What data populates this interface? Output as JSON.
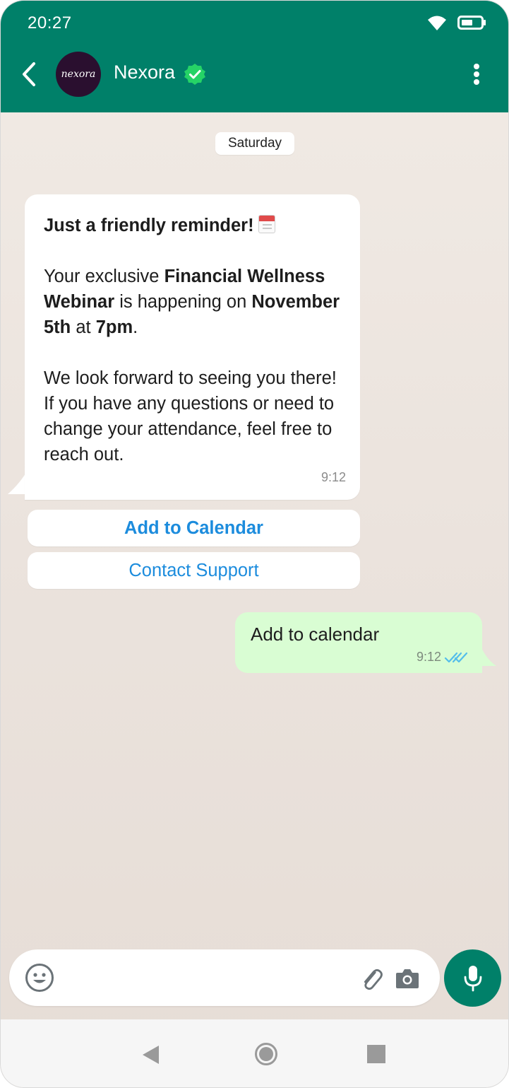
{
  "status_bar": {
    "time": "20:27",
    "wifi_icon": "wifi-icon",
    "battery_icon": "battery-icon"
  },
  "header": {
    "contact_name": "Nexora",
    "avatar_text": "nexora",
    "verified_icon": "verified-badge-icon",
    "back_icon": "back-arrow-icon",
    "menu_icon": "more-vert-icon",
    "bg_color": "#008069"
  },
  "chat": {
    "date_label": "Saturday",
    "incoming": {
      "heading": "Just a friendly reminder!",
      "p2_pre": "Your exclusive ",
      "p2_bold_1": "Financial Wellness Webinar",
      "p2_mid": " is happening on ",
      "p2_bold_2": "November 5th",
      "p2_mid_2": " at ",
      "p2_bold_3": "7pm",
      "p2_end": ".",
      "p3": "We look forward to seeing you there! If you have any questions or need to change your attendance, feel free to reach out.",
      "time": "9:12"
    },
    "quick_replies": [
      "Add to Calendar",
      "Contact Support"
    ],
    "outgoing": {
      "text": "Add to calendar",
      "time": "9:12",
      "status_icon": "double-check-icon"
    }
  },
  "input_bar": {
    "placeholder": "",
    "emoji_icon": "emoji-icon",
    "attach_icon": "paperclip-icon",
    "camera_icon": "camera-icon",
    "mic_icon": "mic-icon"
  },
  "nav_bar": {
    "back": "nav-back-icon",
    "home": "nav-home-icon",
    "recents": "nav-recents-icon"
  },
  "colors": {
    "accent": "#008069",
    "link": "#1c8cdd",
    "outgoing_bubble": "#d9fdd3",
    "read_ticks": "#53bdeb"
  }
}
